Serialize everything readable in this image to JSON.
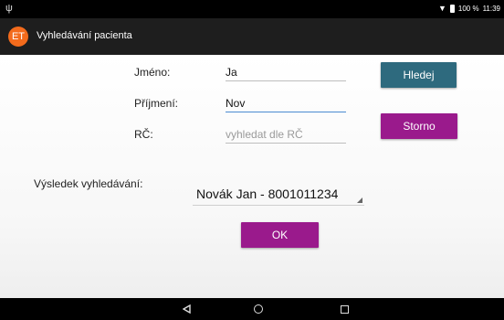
{
  "status_bar": {
    "left_icon": "usb-icon",
    "battery_text": "100 %",
    "time": "11:39"
  },
  "app_bar": {
    "logo_text": "ET",
    "title": "Vyhledávání pacienta"
  },
  "form": {
    "first_name_label": "Jméno:",
    "first_name_value": "Ja",
    "last_name_label": "Příjmení:",
    "last_name_value": "Nov",
    "rc_label": "RČ:",
    "rc_placeholder": "vyhledat dle RČ",
    "rc_value": ""
  },
  "buttons": {
    "search_label": "Hledej",
    "cancel_label": "Storno",
    "ok_label": "OK"
  },
  "results": {
    "label": "Výsledek vyhledávání:",
    "selected_value": "Novák Jan - 8001011234"
  },
  "nav_bar": {
    "back_icon": "back-triangle-icon",
    "home_icon": "home-circle-icon",
    "recent_icon": "recent-square-icon"
  },
  "colors": {
    "app_bar": "#1e1e1e",
    "status_bar": "#000000",
    "logo": "#f36b1c",
    "search_button": "#2e6a7e",
    "purple_button": "#9a1a8c",
    "focus_underline": "#4a8bd1"
  }
}
